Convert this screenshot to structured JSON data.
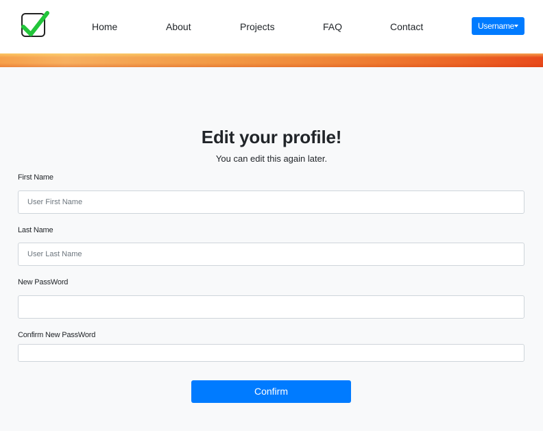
{
  "nav": {
    "logo": "checkmark-logo",
    "links": [
      "Home",
      "About",
      "Projects",
      "FAQ",
      "Contact"
    ],
    "user_button": "Username"
  },
  "page": {
    "title": "Edit your profile!",
    "subtitle": "You can edit this again later."
  },
  "form": {
    "first_name": {
      "label": "First Name",
      "placeholder": "User First Name",
      "value": ""
    },
    "last_name": {
      "label": "Last Name",
      "placeholder": "User Last Name",
      "value": ""
    },
    "new_password": {
      "label": "New PassWord",
      "placeholder": "",
      "value": ""
    },
    "confirm_password": {
      "label": "Confirm New PassWord",
      "placeholder": "",
      "value": ""
    },
    "submit_label": "Confirm"
  },
  "colors": {
    "accent": "#007bff",
    "check": "#22c53a",
    "banner_start": "#f6a04a",
    "banner_end": "#e84a1c",
    "background": "#f8f9fa"
  }
}
